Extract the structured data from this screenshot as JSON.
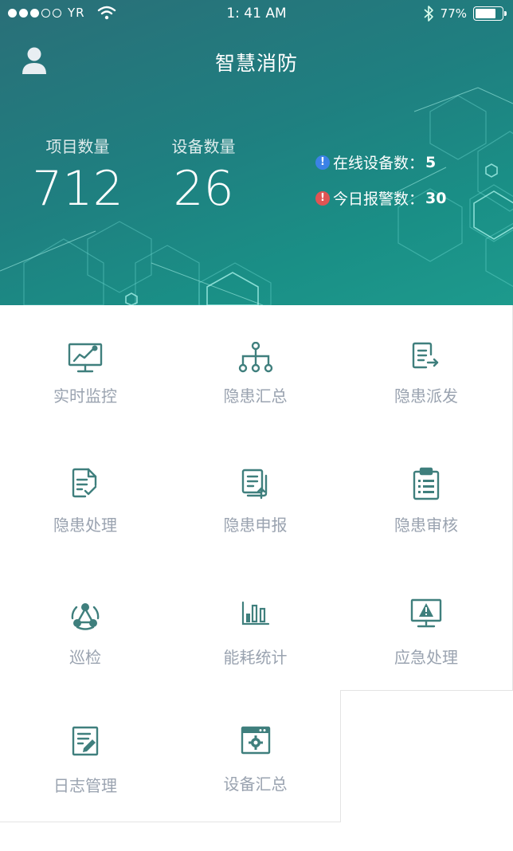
{
  "status_bar": {
    "carrier": "YR",
    "time": "1: 41 AM",
    "battery": "77%",
    "battery_level": 0.77
  },
  "header": {
    "title": "智慧消防",
    "stats": [
      {
        "label": "项目数量",
        "value": "712"
      },
      {
        "label": "设备数量",
        "value": "26"
      }
    ],
    "info": [
      {
        "label": "在线设备数：",
        "value": "5",
        "color": "#3b82e6"
      },
      {
        "label": "今日报警数：",
        "value": "30",
        "color": "#e05454"
      }
    ]
  },
  "menu": {
    "items": [
      {
        "label": "实时监控",
        "icon": "monitor-chart-icon"
      },
      {
        "label": "隐患汇总",
        "icon": "hierarchy-icon"
      },
      {
        "label": "隐患派发",
        "icon": "document-send-icon"
      },
      {
        "label": "隐患处理",
        "icon": "document-check-icon"
      },
      {
        "label": "隐患申报",
        "icon": "documents-upload-icon"
      },
      {
        "label": "隐患审核",
        "icon": "clipboard-list-icon"
      },
      {
        "label": "巡检",
        "icon": "patrol-network-icon"
      },
      {
        "label": "能耗统计",
        "icon": "bar-chart-icon"
      },
      {
        "label": "应急处理",
        "icon": "monitor-warning-icon"
      },
      {
        "label": "日志管理",
        "icon": "log-edit-icon"
      },
      {
        "label": "设备汇总",
        "icon": "device-settings-icon"
      }
    ]
  },
  "colors": {
    "icon": "#3f7f7d",
    "label": "#9aa3b0",
    "header_start": "#2a6f78",
    "header_end": "#1d9a8d"
  }
}
